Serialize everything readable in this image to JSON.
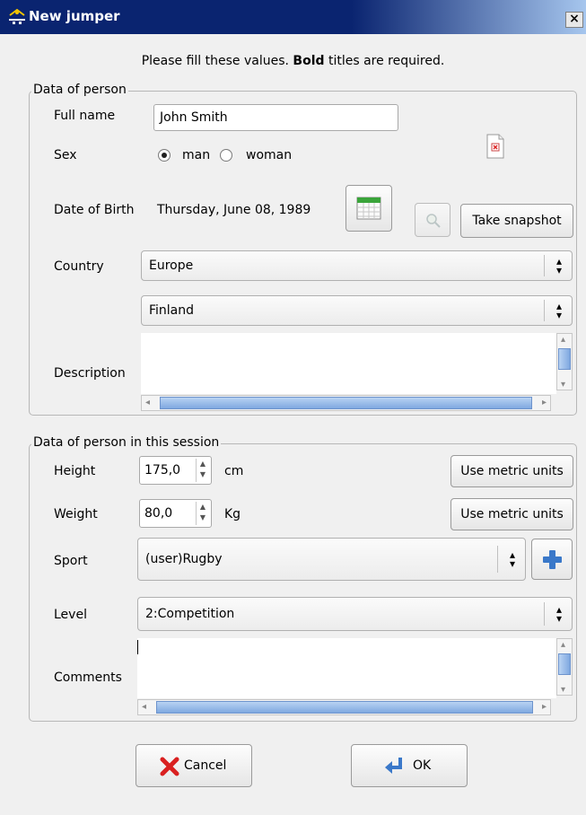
{
  "window": {
    "title": "New jumper",
    "close_glyph": "×"
  },
  "intro": {
    "prefix": "Please fill these values. ",
    "bold": "Bold",
    "suffix": " titles are required."
  },
  "person": {
    "legend": "Data of person",
    "full_name_label": "Full name",
    "full_name_value": "John Smith",
    "sex_label": "Sex",
    "sex_options": [
      "man",
      "woman"
    ],
    "sex_selected": "man",
    "dob_label": "Date of Birth",
    "dob_value": "Thursday, June 08, 1989",
    "take_snapshot": "Take snapshot",
    "country_label": "Country",
    "continent_value": "Europe",
    "country_value": "Finland",
    "description_label": "Description",
    "description_value": ""
  },
  "session": {
    "legend": "Data of person in this session",
    "height_label": "Height",
    "height_value": "175,0",
    "height_unit": "cm",
    "weight_label": "Weight",
    "weight_value": "80,0",
    "weight_unit": "Kg",
    "metric_button": "Use metric units",
    "sport_label": "Sport",
    "sport_value": "(user)Rugby",
    "level_label": "Level",
    "level_value": "2:Competition",
    "comments_label": "Comments",
    "comments_value": ""
  },
  "buttons": {
    "cancel": "Cancel",
    "ok": "OK"
  },
  "icons": {
    "app": "jumper-app-icon",
    "photo": "photo-placeholder-icon",
    "calendar": "calendar-icon",
    "zoom": "zoom-icon",
    "add": "plus-icon",
    "cancel": "red-x-icon",
    "ok": "enter-arrow-icon"
  },
  "colors": {
    "title_bar": "#0a2470",
    "scroll_thumb": "#7fa8e0",
    "add_icon": "#3a78c9",
    "cancel_icon": "#d92020"
  }
}
